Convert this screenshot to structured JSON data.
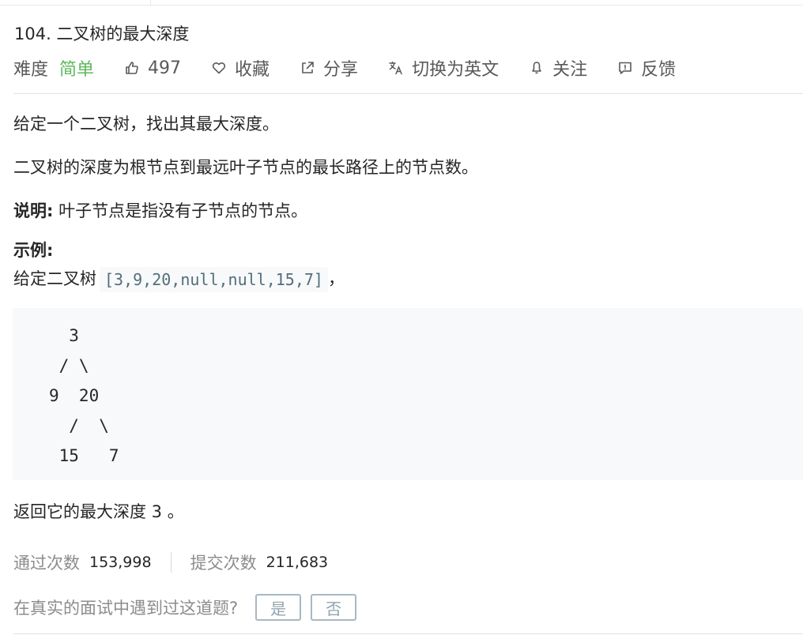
{
  "problem": {
    "title": "104. 二叉树的最大深度",
    "difficulty_label": "难度",
    "difficulty": "简单",
    "likes": "497",
    "favorite_label": "收藏",
    "share_label": "分享",
    "translate_label": "切换为英文",
    "follow_label": "关注",
    "feedback_label": "反馈"
  },
  "description": {
    "line1": "给定一个二叉树，找出其最大深度。",
    "line2": "二叉树的深度为根节点到最远叶子节点的最长路径上的节点数。",
    "note_label": "说明:",
    "note_text": " 叶子节点是指没有子节点的节点。",
    "example_label": "示例:",
    "example_intro": "给定二叉树",
    "example_input": "[3,9,20,null,null,15,7]",
    "example_suffix": "，",
    "tree_ascii": "  3\n / \\\n9  20\n  /  \\\n 15   7",
    "result_text": "返回它的最大深度 3 。"
  },
  "stats": {
    "accepted_label": "通过次数",
    "accepted_value": "153,998",
    "submitted_label": "提交次数",
    "submitted_value": "211,683"
  },
  "interview": {
    "question": "在真实的面试中遇到过这道题?",
    "yes_label": "是",
    "no_label": "否"
  },
  "icons": {
    "like": "thumbs-up-icon",
    "favorite": "heart-icon",
    "share": "share-icon",
    "translate": "translate-icon",
    "follow": "bell-icon",
    "feedback": "feedback-icon"
  },
  "colors": {
    "difficulty_easy": "#5cb85c",
    "code_text": "#546e7a",
    "code_bg": "#f7f9fa",
    "muted": "#8c8c8c"
  }
}
